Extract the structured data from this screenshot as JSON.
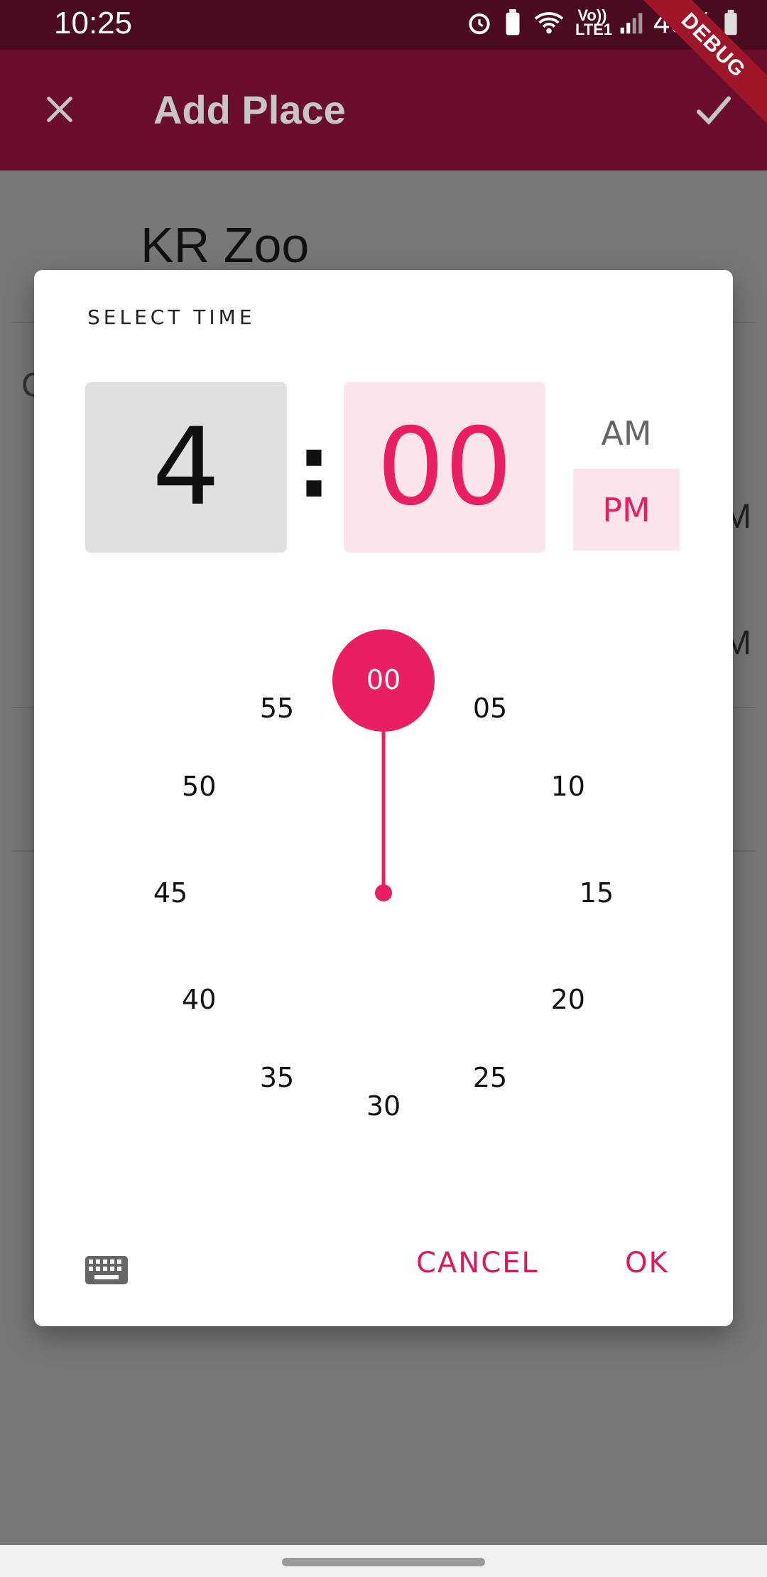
{
  "status_bar": {
    "time": "10:25",
    "signal_label": "Vo)) LTE1",
    "battery": "46%"
  },
  "app_bar": {
    "title": "Add Place",
    "debug_banner": "DEBUG"
  },
  "background": {
    "place_name": "KR Zoo",
    "partial_text_1": "M",
    "partial_text_2": "M",
    "partial_text_3": "C"
  },
  "time_picker": {
    "title": "SELECT TIME",
    "hour": "4",
    "separator": ":",
    "minute": "00",
    "am_label": "AM",
    "pm_label": "PM",
    "selected_period": "PM",
    "dial_numbers": [
      "00",
      "05",
      "10",
      "15",
      "20",
      "25",
      "30",
      "35",
      "40",
      "45",
      "50",
      "55"
    ],
    "selected_minute": "00",
    "cancel_label": "CANCEL",
    "ok_label": "OK"
  },
  "colors": {
    "accent": "#e91e63",
    "accent_light": "#fce4ec",
    "app_bar": "#6b0e2d",
    "status_bar": "#4a0a1f"
  },
  "icons": {
    "close": "close-icon",
    "check": "check-icon",
    "keyboard": "keyboard-icon"
  }
}
